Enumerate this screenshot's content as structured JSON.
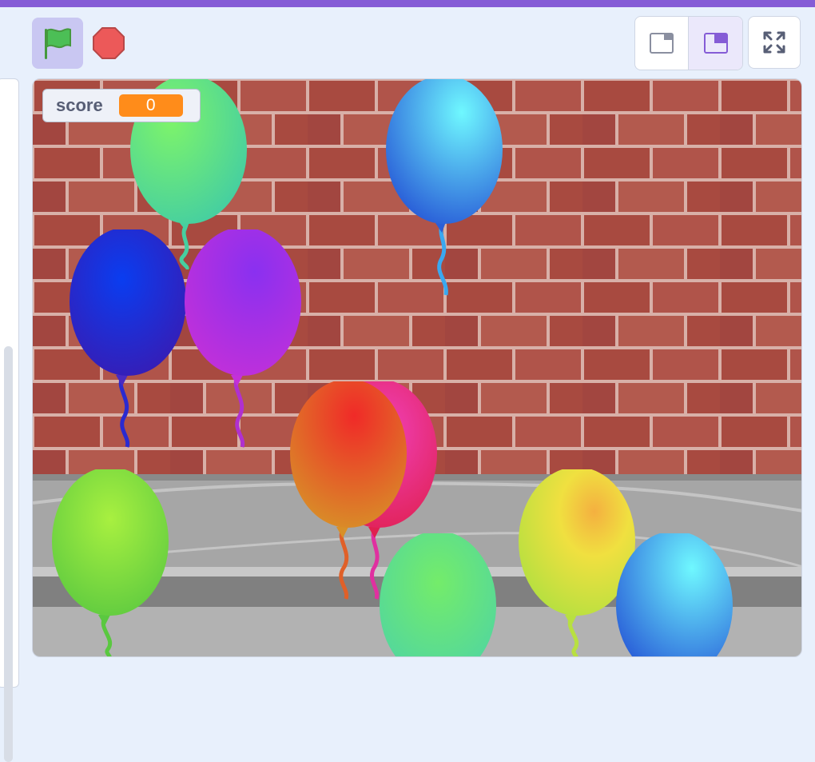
{
  "controls": {
    "green_flag_icon": "green-flag-icon",
    "stop_icon": "stop-sign-icon"
  },
  "stage_layout": {
    "small_stage_icon": "small-stage-layout-icon",
    "large_stage_icon": "large-stage-layout-icon",
    "fullscreen_icon": "fullscreen-icon"
  },
  "monitor": {
    "label": "score",
    "value": "0"
  },
  "colors": {
    "accent": "#855cd6",
    "monitor_value_bg": "#ff8c1a",
    "brick": "#a84a40",
    "mortar": "#d8b0a8"
  },
  "sprites": [
    {
      "name": "balloon",
      "color": "green"
    },
    {
      "name": "balloon",
      "color": "light-blue"
    },
    {
      "name": "balloon",
      "color": "dark-blue"
    },
    {
      "name": "balloon",
      "color": "purple"
    },
    {
      "name": "balloon",
      "color": "pink"
    },
    {
      "name": "balloon",
      "color": "orange-red"
    },
    {
      "name": "balloon",
      "color": "lime-green"
    },
    {
      "name": "balloon",
      "color": "mint-green"
    },
    {
      "name": "balloon",
      "color": "yellow"
    },
    {
      "name": "balloon",
      "color": "sky-blue"
    }
  ]
}
